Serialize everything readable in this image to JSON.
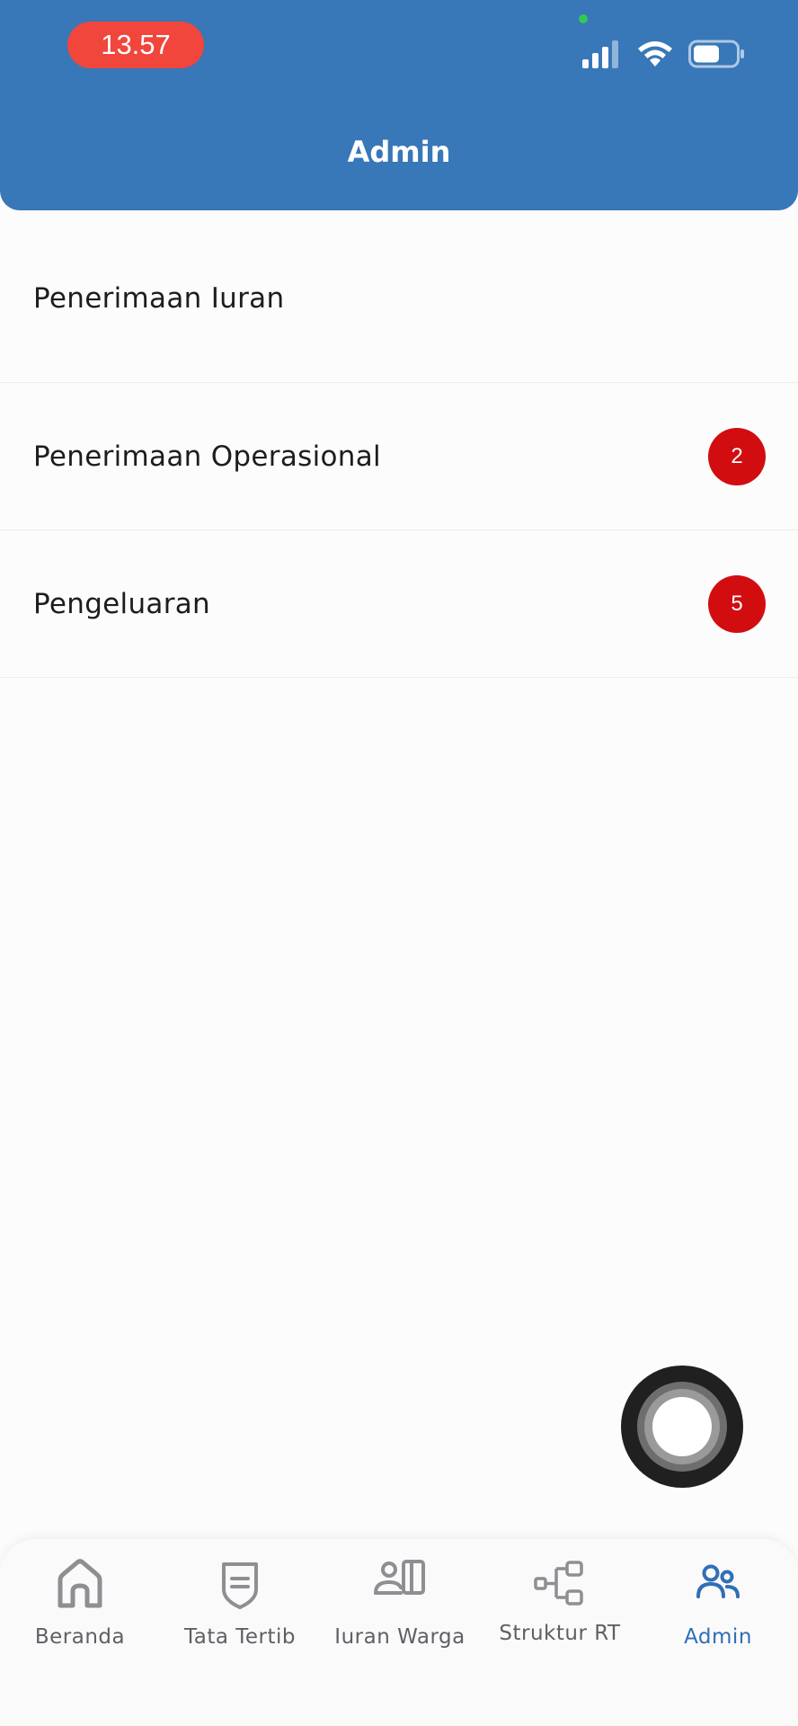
{
  "status_bar": {
    "time": "13.57"
  },
  "header": {
    "title": "Admin"
  },
  "menu": [
    {
      "label": "Penerimaan Iuran",
      "badge": null
    },
    {
      "label": "Penerimaan Operasional",
      "badge": "2"
    },
    {
      "label": "Pengeluaran",
      "badge": "5"
    }
  ],
  "bottom_nav": [
    {
      "label": "Beranda",
      "icon": "home-icon",
      "active": false
    },
    {
      "label": "Tata Tertib",
      "icon": "shield-document-icon",
      "active": false
    },
    {
      "label": "Iuran Warga",
      "icon": "user-card-icon",
      "active": false
    },
    {
      "label": "Struktur RT",
      "icon": "hierarchy-icon",
      "active": false
    },
    {
      "label": "Admin",
      "icon": "users-icon",
      "active": true
    }
  ],
  "colors": {
    "header": "#3877b8",
    "badge": "#d20d10",
    "time_pill": "#f0463c",
    "nav_active": "#2f6fb5",
    "nav_inactive": "#5f5f64"
  }
}
